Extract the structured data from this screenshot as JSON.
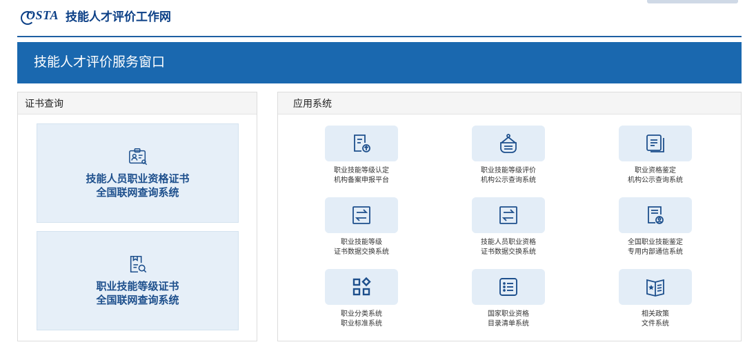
{
  "header": {
    "logo_text": "OSTA",
    "site_title": "技能人才评价工作网"
  },
  "banner": {
    "title": "技能人才评价服务窗口"
  },
  "certificates": {
    "heading": "证书查询",
    "cards": [
      {
        "line1": "技能人员职业资格证书",
        "line2": "全国联网查询系统",
        "icon": "id-card-search-icon"
      },
      {
        "line1": "职业技能等级证书",
        "line2": "全国联网查询系统",
        "icon": "document-search-icon"
      }
    ]
  },
  "apps": {
    "heading": "应用系统",
    "items": [
      {
        "line1": "职业技能等级认定",
        "line2": "机构备案申报平台",
        "icon": "upload-document-icon"
      },
      {
        "line1": "职业技能等级评价",
        "line2": "机构公示查询系统",
        "icon": "hanging-sign-icon"
      },
      {
        "line1": "职业资格鉴定",
        "line2": "机构公示查询系统",
        "icon": "document-stack-icon"
      },
      {
        "line1": "职业技能等级",
        "line2": "证书数据交换系统",
        "icon": "exchange-arrows-icon"
      },
      {
        "line1": "技能人员职业资格",
        "line2": "证书数据交换系统",
        "icon": "exchange-arrows-icon"
      },
      {
        "line1": "全国职业技能鉴定",
        "line2": "专用内部通信系统",
        "icon": "document-user-icon"
      },
      {
        "line1": "职业分类系统",
        "line2": "职业标准系统",
        "icon": "category-grid-icon"
      },
      {
        "line1": "国家职业资格",
        "line2": "目录清单系统",
        "icon": "list-icon"
      },
      {
        "line1": "相关政策",
        "line2": "文件系统",
        "icon": "star-book-icon"
      }
    ]
  },
  "colors": {
    "brand_blue": "#1a68af",
    "dark_blue": "#0b3f86",
    "card_bg": "#e6eff8"
  }
}
